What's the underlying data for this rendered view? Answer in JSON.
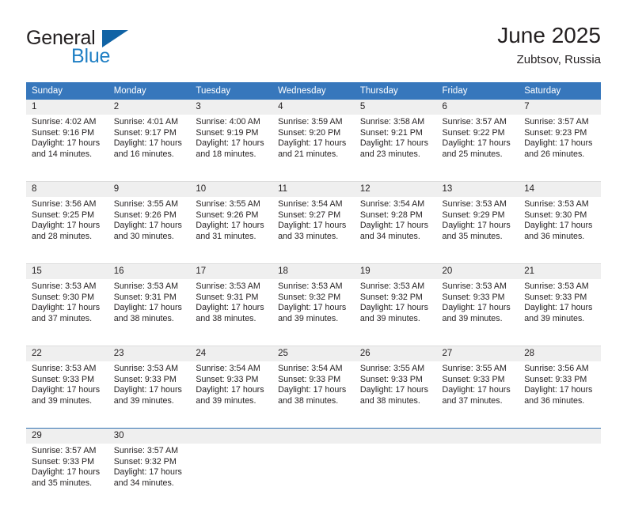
{
  "brand": {
    "name_part1": "General",
    "name_part2": "Blue",
    "logo_icon": "triangle-logo-icon"
  },
  "header": {
    "title": "June 2025",
    "location": "Zubtsov, Russia"
  },
  "colors": {
    "header_blue": "#3777bc",
    "brand_blue": "#1f7fc4",
    "logo_blue": "#1063a5",
    "daynum_band": "#efefef",
    "separator": "#dcdcdc",
    "last_separator": "#2f6fb0",
    "text": "#231f20"
  },
  "weekdays": [
    "Sunday",
    "Monday",
    "Tuesday",
    "Wednesday",
    "Thursday",
    "Friday",
    "Saturday"
  ],
  "weeks": [
    [
      {
        "day": "1",
        "sunrise": "Sunrise: 4:02 AM",
        "sunset": "Sunset: 9:16 PM",
        "daylight1": "Daylight: 17 hours",
        "daylight2": "and 14 minutes."
      },
      {
        "day": "2",
        "sunrise": "Sunrise: 4:01 AM",
        "sunset": "Sunset: 9:17 PM",
        "daylight1": "Daylight: 17 hours",
        "daylight2": "and 16 minutes."
      },
      {
        "day": "3",
        "sunrise": "Sunrise: 4:00 AM",
        "sunset": "Sunset: 9:19 PM",
        "daylight1": "Daylight: 17 hours",
        "daylight2": "and 18 minutes."
      },
      {
        "day": "4",
        "sunrise": "Sunrise: 3:59 AM",
        "sunset": "Sunset: 9:20 PM",
        "daylight1": "Daylight: 17 hours",
        "daylight2": "and 21 minutes."
      },
      {
        "day": "5",
        "sunrise": "Sunrise: 3:58 AM",
        "sunset": "Sunset: 9:21 PM",
        "daylight1": "Daylight: 17 hours",
        "daylight2": "and 23 minutes."
      },
      {
        "day": "6",
        "sunrise": "Sunrise: 3:57 AM",
        "sunset": "Sunset: 9:22 PM",
        "daylight1": "Daylight: 17 hours",
        "daylight2": "and 25 minutes."
      },
      {
        "day": "7",
        "sunrise": "Sunrise: 3:57 AM",
        "sunset": "Sunset: 9:23 PM",
        "daylight1": "Daylight: 17 hours",
        "daylight2": "and 26 minutes."
      }
    ],
    [
      {
        "day": "8",
        "sunrise": "Sunrise: 3:56 AM",
        "sunset": "Sunset: 9:25 PM",
        "daylight1": "Daylight: 17 hours",
        "daylight2": "and 28 minutes."
      },
      {
        "day": "9",
        "sunrise": "Sunrise: 3:55 AM",
        "sunset": "Sunset: 9:26 PM",
        "daylight1": "Daylight: 17 hours",
        "daylight2": "and 30 minutes."
      },
      {
        "day": "10",
        "sunrise": "Sunrise: 3:55 AM",
        "sunset": "Sunset: 9:26 PM",
        "daylight1": "Daylight: 17 hours",
        "daylight2": "and 31 minutes."
      },
      {
        "day": "11",
        "sunrise": "Sunrise: 3:54 AM",
        "sunset": "Sunset: 9:27 PM",
        "daylight1": "Daylight: 17 hours",
        "daylight2": "and 33 minutes."
      },
      {
        "day": "12",
        "sunrise": "Sunrise: 3:54 AM",
        "sunset": "Sunset: 9:28 PM",
        "daylight1": "Daylight: 17 hours",
        "daylight2": "and 34 minutes."
      },
      {
        "day": "13",
        "sunrise": "Sunrise: 3:53 AM",
        "sunset": "Sunset: 9:29 PM",
        "daylight1": "Daylight: 17 hours",
        "daylight2": "and 35 minutes."
      },
      {
        "day": "14",
        "sunrise": "Sunrise: 3:53 AM",
        "sunset": "Sunset: 9:30 PM",
        "daylight1": "Daylight: 17 hours",
        "daylight2": "and 36 minutes."
      }
    ],
    [
      {
        "day": "15",
        "sunrise": "Sunrise: 3:53 AM",
        "sunset": "Sunset: 9:30 PM",
        "daylight1": "Daylight: 17 hours",
        "daylight2": "and 37 minutes."
      },
      {
        "day": "16",
        "sunrise": "Sunrise: 3:53 AM",
        "sunset": "Sunset: 9:31 PM",
        "daylight1": "Daylight: 17 hours",
        "daylight2": "and 38 minutes."
      },
      {
        "day": "17",
        "sunrise": "Sunrise: 3:53 AM",
        "sunset": "Sunset: 9:31 PM",
        "daylight1": "Daylight: 17 hours",
        "daylight2": "and 38 minutes."
      },
      {
        "day": "18",
        "sunrise": "Sunrise: 3:53 AM",
        "sunset": "Sunset: 9:32 PM",
        "daylight1": "Daylight: 17 hours",
        "daylight2": "and 39 minutes."
      },
      {
        "day": "19",
        "sunrise": "Sunrise: 3:53 AM",
        "sunset": "Sunset: 9:32 PM",
        "daylight1": "Daylight: 17 hours",
        "daylight2": "and 39 minutes."
      },
      {
        "day": "20",
        "sunrise": "Sunrise: 3:53 AM",
        "sunset": "Sunset: 9:33 PM",
        "daylight1": "Daylight: 17 hours",
        "daylight2": "and 39 minutes."
      },
      {
        "day": "21",
        "sunrise": "Sunrise: 3:53 AM",
        "sunset": "Sunset: 9:33 PM",
        "daylight1": "Daylight: 17 hours",
        "daylight2": "and 39 minutes."
      }
    ],
    [
      {
        "day": "22",
        "sunrise": "Sunrise: 3:53 AM",
        "sunset": "Sunset: 9:33 PM",
        "daylight1": "Daylight: 17 hours",
        "daylight2": "and 39 minutes."
      },
      {
        "day": "23",
        "sunrise": "Sunrise: 3:53 AM",
        "sunset": "Sunset: 9:33 PM",
        "daylight1": "Daylight: 17 hours",
        "daylight2": "and 39 minutes."
      },
      {
        "day": "24",
        "sunrise": "Sunrise: 3:54 AM",
        "sunset": "Sunset: 9:33 PM",
        "daylight1": "Daylight: 17 hours",
        "daylight2": "and 39 minutes."
      },
      {
        "day": "25",
        "sunrise": "Sunrise: 3:54 AM",
        "sunset": "Sunset: 9:33 PM",
        "daylight1": "Daylight: 17 hours",
        "daylight2": "and 38 minutes."
      },
      {
        "day": "26",
        "sunrise": "Sunrise: 3:55 AM",
        "sunset": "Sunset: 9:33 PM",
        "daylight1": "Daylight: 17 hours",
        "daylight2": "and 38 minutes."
      },
      {
        "day": "27",
        "sunrise": "Sunrise: 3:55 AM",
        "sunset": "Sunset: 9:33 PM",
        "daylight1": "Daylight: 17 hours",
        "daylight2": "and 37 minutes."
      },
      {
        "day": "28",
        "sunrise": "Sunrise: 3:56 AM",
        "sunset": "Sunset: 9:33 PM",
        "daylight1": "Daylight: 17 hours",
        "daylight2": "and 36 minutes."
      }
    ],
    [
      {
        "day": "29",
        "sunrise": "Sunrise: 3:57 AM",
        "sunset": "Sunset: 9:33 PM",
        "daylight1": "Daylight: 17 hours",
        "daylight2": "and 35 minutes."
      },
      {
        "day": "30",
        "sunrise": "Sunrise: 3:57 AM",
        "sunset": "Sunset: 9:32 PM",
        "daylight1": "Daylight: 17 hours",
        "daylight2": "and 34 minutes."
      },
      null,
      null,
      null,
      null,
      null
    ]
  ]
}
